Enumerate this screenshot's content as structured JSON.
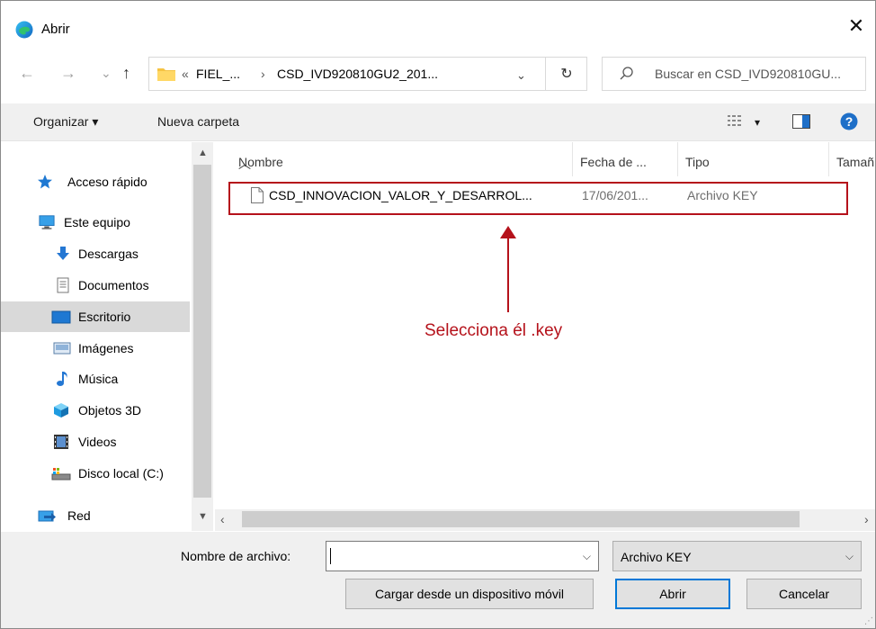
{
  "window": {
    "title": "Abrir",
    "close_symbol": "✕"
  },
  "navigation": {
    "back": "←",
    "forward": "→",
    "recent": "⌄",
    "up": "↑"
  },
  "address": {
    "crumbs": [
      "«",
      "FIEL_...",
      "›",
      "CSD_IVD920810GU2_201..."
    ],
    "dropdown_symbol": "⌄",
    "refresh_symbol": "↻"
  },
  "search": {
    "placeholder": "Buscar en CSD_IVD920810GU..."
  },
  "toolbar": {
    "organize_label": "Organizar ▾",
    "new_folder_label": "Nueva carpeta",
    "view_dropdown": "▾"
  },
  "sidebar": {
    "items": [
      {
        "label": "Acceso rápido",
        "icon": "star-icon"
      },
      {
        "label": "Este equipo",
        "icon": "computer-icon"
      },
      {
        "label": "Descargas",
        "icon": "download-icon"
      },
      {
        "label": "Documentos",
        "icon": "document-icon"
      },
      {
        "label": "Escritorio",
        "icon": "desktop-icon",
        "selected": true
      },
      {
        "label": "Imágenes",
        "icon": "pictures-icon"
      },
      {
        "label": "Música",
        "icon": "music-icon"
      },
      {
        "label": "Objetos 3D",
        "icon": "cube-icon"
      },
      {
        "label": "Videos",
        "icon": "video-icon"
      },
      {
        "label": "Disco local (C:)",
        "icon": "drive-icon"
      },
      {
        "label": "Red",
        "icon": "network-icon"
      }
    ]
  },
  "file_list": {
    "columns": [
      "Nombre",
      "Fecha de ...",
      "Tipo",
      "Tamañ"
    ],
    "rows": [
      {
        "name": "CSD_INNOVACION_VALOR_Y_DESARROL...",
        "date": "17/06/201...",
        "type": "Archivo KEY"
      }
    ]
  },
  "annotation": {
    "text": "Selecciona él .key",
    "color": "#b5121b"
  },
  "footer": {
    "filename_label": "Nombre de archivo:",
    "filename_value": "",
    "filetype_value": "Archivo KEY",
    "mobile_button": "Cargar desde un dispositivo móvil",
    "open_button": "Abrir",
    "cancel_button": "Cancelar"
  },
  "colors": {
    "accent": "#0078d7",
    "annotation": "#b5121b",
    "selected_bg": "#d9d9d9",
    "pane_bg": "#f0f0f0"
  }
}
